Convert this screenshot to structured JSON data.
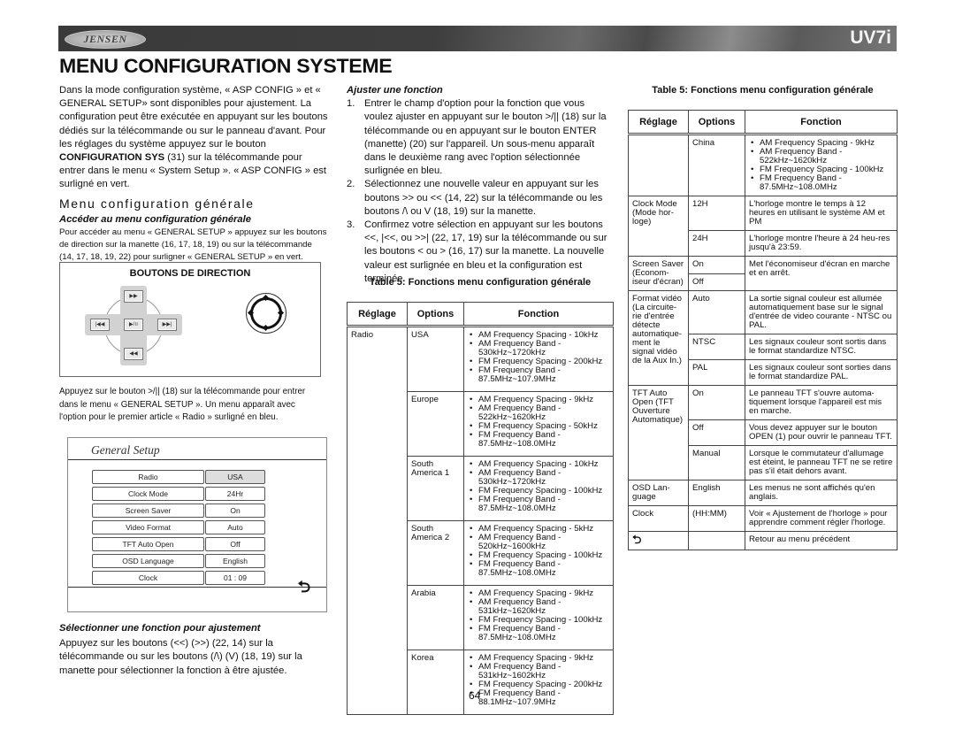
{
  "header": {
    "brand": "JENSEN",
    "model": "UV7i"
  },
  "page_title": "MENU CONFIGURATION SYSTEME",
  "col1": {
    "intro_a": "Dans la mode configuration système, « ASP CONFIG » et « GENERAL SETUP» sont disponibles pour ajustement. La configuration peut être exécutée en appuyant sur les boutons dédiés sur la télécommande ou sur le panneau d'avant. Pour les réglages du système appuyez sur le bouton ",
    "intro_bold": "CONFIGURATION SYS",
    "intro_b": " (31) sur la télécommande pour entrer dans le menu « System Setup ». « ASP CONFIG » est surligné en vert.",
    "section_title": "Menu configuration générale",
    "access_title": "Accéder au menu configuration générale",
    "access_text": "Pour accéder au menu « GENERAL SETUP » appuyez sur les boutons de direction sur la manette (16, 17, 18, 19) ou sur la télécommande (14, 17, 18, 19, 22) pour surligner « GENERAL SETUP » en vert.",
    "direction_box_title": "BOUTONS DE DIRECTION",
    "dpad_labels": {
      "up": "▶▶",
      "left": "|◀◀",
      "center": "▶/॥",
      "right": "▶▶|",
      "down": "◀◀"
    },
    "press_text": "Appuyez sur le bouton >/|| (18) sur la télécommande pour entrer dans le menu « GENERAL SETUP ». Un menu apparaît avec l'option pour le premier article « Radio » surligné en bleu.",
    "general_setup": {
      "title": "General Setup",
      "rows": [
        {
          "label": "Radio",
          "value": "USA",
          "selected": true
        },
        {
          "label": "Clock  Mode",
          "value": "24Hr"
        },
        {
          "label": "Screen Saver",
          "value": "On"
        },
        {
          "label": "Video Format",
          "value": "Auto"
        },
        {
          "label": "TFT Auto Open",
          "value": "Off"
        },
        {
          "label": "OSD Language",
          "value": "English"
        },
        {
          "label": "Clock",
          "value": "01  :  09"
        }
      ],
      "back_icon": "return-arrow"
    },
    "select_title": "Sélectionner une fonction pour ajustement",
    "select_text": "Appuyez sur les boutons (<<) (>>) (22, 14) sur la télécommande ou sur les boutons (/\\) (V)  (18, 19) sur la manette pour sélectionner la fonction à être ajustée."
  },
  "col2": {
    "adjust_title": "Ajuster une fonction",
    "steps": [
      {
        "num": "1.",
        "text": "Entrer le champ d'option pour la fonction que vous voulez ajuster en appuyant sur le bouton >/|| (18) sur la télécommande ou en appuyant sur le bouton ENTER (manette) (20) sur l'appareil. Un sous-menu apparaît dans le deuxième rang avec l'option sélectionnée surlignée en bleu."
      },
      {
        "num": "2.",
        "text": "Sélectionnez une nouvelle valeur en appuyant sur les boutons >> ou << (14, 22) sur la télécommande ou les boutons /\\ ou V (18, 19) sur la manette."
      },
      {
        "num": "3.",
        "text": "Confirmez votre sélection en appuyant sur les boutons <<, |<<, ou >>| (22, 17, 19) sur la télécommande ou sur les boutons < ou > (16, 17) sur la manette. La nouvelle valeur est surlignée en bleu et la configuration est terminée."
      }
    ]
  },
  "table": {
    "caption": "Table 5: Fonctions menu configuration générale",
    "headers": [
      "Réglage",
      "Options",
      "Fonction"
    ],
    "part1": {
      "setting": "Radio",
      "rows": [
        {
          "option": "USA",
          "items": [
            "AM Frequency Spacing - 10kHz",
            "AM Frequency Band - 530kHz~1720kHz",
            "FM Frequency Spacing - 200kHz",
            "FM Frequency Band - 87.5MHz~107.9MHz"
          ]
        },
        {
          "option": "Europe",
          "items": [
            "AM Frequency Spacing - 9kHz",
            "AM Frequency Band - 522kHz~1620kHz",
            "FM Frequency Spacing - 50kHz",
            "FM Frequency Band - 87.5MHz~108.0MHz"
          ]
        },
        {
          "option": "South America 1",
          "items": [
            "AM Frequency Spacing - 10kHz",
            "AM Frequency Band - 530kHz~1720kHz",
            "FM Frequency Spacing - 100kHz",
            "FM Frequency Band - 87.5MHz~108.0MHz"
          ]
        },
        {
          "option": "South America 2",
          "items": [
            "AM Frequency Spacing - 5kHz",
            "AM Frequency Band - 520kHz~1600kHz",
            "FM Frequency Spacing - 100kHz",
            "FM Frequency Band - 87.5MHz~108.0MHz"
          ]
        },
        {
          "option": "Arabia",
          "items": [
            "AM Frequency Spacing - 9kHz",
            "AM Frequency Band - 531kHz~1620kHz",
            "FM Frequency Spacing - 100kHz",
            "FM Frequency Band - 87.5MHz~108.0MHz"
          ]
        },
        {
          "option": "Korea",
          "items": [
            "AM Frequency Spacing - 9kHz",
            "AM Frequency Band - 531kHz~1602kHz",
            "FM Frequency Spacing - 200kHz",
            "FM Frequency Band - 88.1MHz~107.9MHz"
          ]
        }
      ]
    },
    "part2": {
      "china": {
        "option": "China",
        "items": [
          "AM Frequency Spacing - 9kHz",
          "AM Frequency Band - 522kHz~1620kHz",
          "FM Frequency Spacing - 100kHz",
          "FM Frequency Band - 87.5MHz~108.0MHz"
        ]
      },
      "clock_mode": {
        "setting": "Clock Mode (Mode hor-loge)",
        "rows": [
          {
            "option": "12H",
            "text": "L'horloge montre le temps à 12 heures en utilisant le système AM et PM"
          },
          {
            "option": "24H",
            "text": "L'horloge montre l'heure à 24 heu-res jusqu'à 23:59."
          }
        ]
      },
      "screen_saver": {
        "setting": "Screen Saver (Econom-iseur d'écran)",
        "options": [
          "On",
          "Off"
        ],
        "text": "Met l'économiseur d'écran en marche et en arrêt."
      },
      "video": {
        "setting": "Format vidéo (La circuite-rie d'entrée détecte automatique-ment le signal vidéo de la Aux In.)",
        "rows": [
          {
            "option": "Auto",
            "text": "La sortie signal couleur est allumée automatiquement base sur le signal d'entrée de video courante - NTSC ou PAL."
          },
          {
            "option": "NTSC",
            "text": "Les signaux couleur sont sortis dans le format standardize NTSC."
          },
          {
            "option": "PAL",
            "text": "Les signaux couleur sont sorties dans le format standardize PAL."
          }
        ]
      },
      "tft": {
        "setting": "TFT Auto Open (TFT Ouverture Automatique)",
        "rows": [
          {
            "option": "On",
            "text": "Le panneau TFT s'ouvre automa-tiquement lorsque l'appareil est mis en marche."
          },
          {
            "option": "Off",
            "text": "Vous devez appuyer sur le bouton OPEN (1) pour ouvrir le panneau TFT."
          },
          {
            "option": "Manual",
            "text": "Lorsque le commutateur d'allumage est éteint, le panneau TFT ne se retire pas s'il était dehors avant."
          }
        ]
      },
      "osd": {
        "setting": "OSD Lan-guage",
        "option": "English",
        "text": "Les menus ne sont affichés qu'en anglais."
      },
      "clock": {
        "setting": "Clock",
        "option": "(HH:MM)",
        "text": "Voir « Ajustement de l'horloge » pour apprendre comment régler l'horloge."
      },
      "back": {
        "icon": "return-arrow",
        "text": "Retour au menu précédent"
      }
    }
  },
  "page_number": "64"
}
